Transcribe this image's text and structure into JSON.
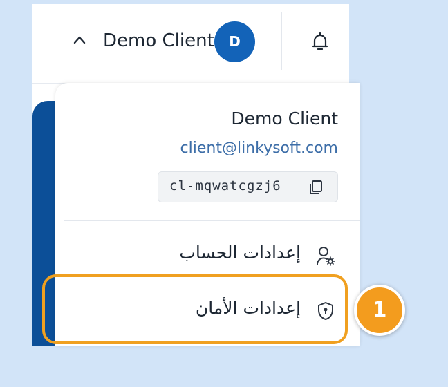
{
  "header": {
    "user_name": "Demo Client",
    "avatar_initial": "D"
  },
  "dropdown": {
    "name": "Demo Client",
    "email": "client@linkysoft.com",
    "client_id": "cl-mqwatcgzj6",
    "menu": [
      {
        "label": "إعدادات الحساب",
        "icon": "user-gear-icon"
      },
      {
        "label": "إعدادات الأمان",
        "icon": "shield-lock-icon"
      }
    ]
  },
  "annotation": {
    "step_number": "1",
    "color": "#f39c1e"
  },
  "colors": {
    "background": "#d2e4f8",
    "brand_blue": "#1363b8",
    "sidebar_blue": "#0c4f98",
    "email_blue": "#3d6ea8"
  }
}
